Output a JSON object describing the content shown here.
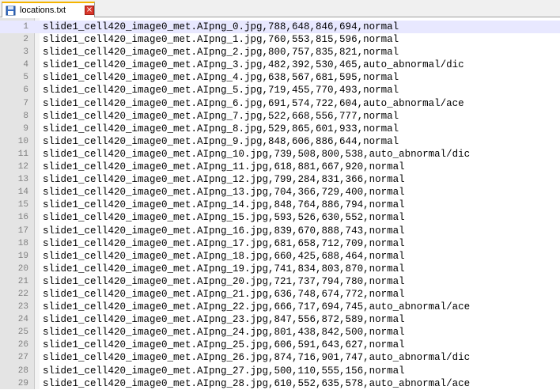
{
  "tab": {
    "title": "locations.txt",
    "close_glyph": "×",
    "icons": {
      "file": "file-icon",
      "close": "close-icon"
    },
    "colors": {
      "accent": "#f4b400",
      "close": "#d9372b"
    }
  },
  "editor": {
    "current_line": 1,
    "current_line_color": "#e8e8ff",
    "lines": [
      {
        "n": "1",
        "text": "slide1_cell420_image0_met.AIpng_0.jpg,788,648,846,694,normal"
      },
      {
        "n": "2",
        "text": "slide1_cell420_image0_met.AIpng_1.jpg,760,553,815,596,normal"
      },
      {
        "n": "3",
        "text": "slide1_cell420_image0_met.AIpng_2.jpg,800,757,835,821,normal"
      },
      {
        "n": "4",
        "text": "slide1_cell420_image0_met.AIpng_3.jpg,482,392,530,465,auto_abnormal/dic"
      },
      {
        "n": "5",
        "text": "slide1_cell420_image0_met.AIpng_4.jpg,638,567,681,595,normal"
      },
      {
        "n": "6",
        "text": "slide1_cell420_image0_met.AIpng_5.jpg,719,455,770,493,normal"
      },
      {
        "n": "7",
        "text": "slide1_cell420_image0_met.AIpng_6.jpg,691,574,722,604,auto_abnormal/ace"
      },
      {
        "n": "8",
        "text": "slide1_cell420_image0_met.AIpng_7.jpg,522,668,556,777,normal"
      },
      {
        "n": "9",
        "text": "slide1_cell420_image0_met.AIpng_8.jpg,529,865,601,933,normal"
      },
      {
        "n": "10",
        "text": "slide1_cell420_image0_met.AIpng_9.jpg,848,606,886,644,normal"
      },
      {
        "n": "11",
        "text": "slide1_cell420_image0_met.AIpng_10.jpg,739,508,800,538,auto_abnormal/dic"
      },
      {
        "n": "12",
        "text": "slide1_cell420_image0_met.AIpng_11.jpg,618,881,667,920,normal"
      },
      {
        "n": "13",
        "text": "slide1_cell420_image0_met.AIpng_12.jpg,799,284,831,366,normal"
      },
      {
        "n": "14",
        "text": "slide1_cell420_image0_met.AIpng_13.jpg,704,366,729,400,normal"
      },
      {
        "n": "15",
        "text": "slide1_cell420_image0_met.AIpng_14.jpg,848,764,886,794,normal"
      },
      {
        "n": "16",
        "text": "slide1_cell420_image0_met.AIpng_15.jpg,593,526,630,552,normal"
      },
      {
        "n": "17",
        "text": "slide1_cell420_image0_met.AIpng_16.jpg,839,670,888,743,normal"
      },
      {
        "n": "18",
        "text": "slide1_cell420_image0_met.AIpng_17.jpg,681,658,712,709,normal"
      },
      {
        "n": "19",
        "text": "slide1_cell420_image0_met.AIpng_18.jpg,660,425,688,464,normal"
      },
      {
        "n": "20",
        "text": "slide1_cell420_image0_met.AIpng_19.jpg,741,834,803,870,normal"
      },
      {
        "n": "21",
        "text": "slide1_cell420_image0_met.AIpng_20.jpg,721,737,794,780,normal"
      },
      {
        "n": "22",
        "text": "slide1_cell420_image0_met.AIpng_21.jpg,636,748,674,772,normal"
      },
      {
        "n": "23",
        "text": "slide1_cell420_image0_met.AIpng_22.jpg,666,717,694,745,auto_abnormal/ace"
      },
      {
        "n": "24",
        "text": "slide1_cell420_image0_met.AIpng_23.jpg,847,556,872,589,normal"
      },
      {
        "n": "25",
        "text": "slide1_cell420_image0_met.AIpng_24.jpg,801,438,842,500,normal"
      },
      {
        "n": "26",
        "text": "slide1_cell420_image0_met.AIpng_25.jpg,606,591,643,627,normal"
      },
      {
        "n": "27",
        "text": "slide1_cell420_image0_met.AIpng_26.jpg,874,716,901,747,auto_abnormal/dic"
      },
      {
        "n": "28",
        "text": "slide1_cell420_image0_met.AIpng_27.jpg,500,110,555,156,normal"
      },
      {
        "n": "29",
        "text": "slide1_cell420_image0_met.AIpng_28.jpg,610,552,635,578,auto_abnormal/ace"
      }
    ]
  }
}
